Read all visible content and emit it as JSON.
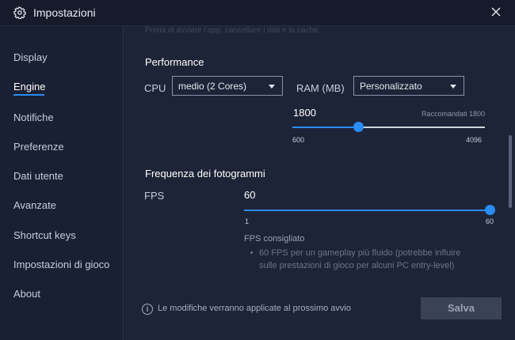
{
  "window": {
    "title": "Impostazioni"
  },
  "sidebar": {
    "items": [
      {
        "label": "Display"
      },
      {
        "label": "Engine"
      },
      {
        "label": "Notifiche"
      },
      {
        "label": "Preferenze"
      },
      {
        "label": "Dati utente"
      },
      {
        "label": "Avanzate"
      },
      {
        "label": "Shortcut keys"
      },
      {
        "label": "Impostazioni di gioco"
      },
      {
        "label": "About"
      }
    ],
    "active": "Engine"
  },
  "content": {
    "faded_top": "Prima di avviare l'app, cancellare i dati e la cache.",
    "performance": {
      "title": "Performance",
      "cpu_label": "CPU",
      "cpu_value": "medio (2 Cores)",
      "ram_label": "RAM (MB)",
      "ram_value": "Personalizzato",
      "ram_slider": {
        "value": 1800,
        "value_text": "1800",
        "min": 600,
        "min_text": "600",
        "max": 4096,
        "max_text": "4096",
        "recommended_text": "Raccomandati 1800"
      }
    },
    "framerate": {
      "title": "Frequenza dei fotogrammi",
      "fps_label": "FPS",
      "fps_slider": {
        "value": 60,
        "value_text": "60",
        "min": 1,
        "min_text": "1",
        "max": 60,
        "max_text": "60"
      },
      "hint_title": "FPS consigliato",
      "hint_detail": "60 FPS per un gameplay più fluido (potrebbe influire sulle prestazioni di gioco per alcuni PC entry-level)"
    }
  },
  "footer": {
    "info_text": "Le modifiche verranno applicate al prossimo avvio",
    "save_label": "Salva"
  },
  "colors": {
    "accent": "#2a8cf5",
    "sidebar_bg": "#1a2033",
    "content_bg": "#1e2438",
    "titlebar_bg": "#161b2c"
  }
}
